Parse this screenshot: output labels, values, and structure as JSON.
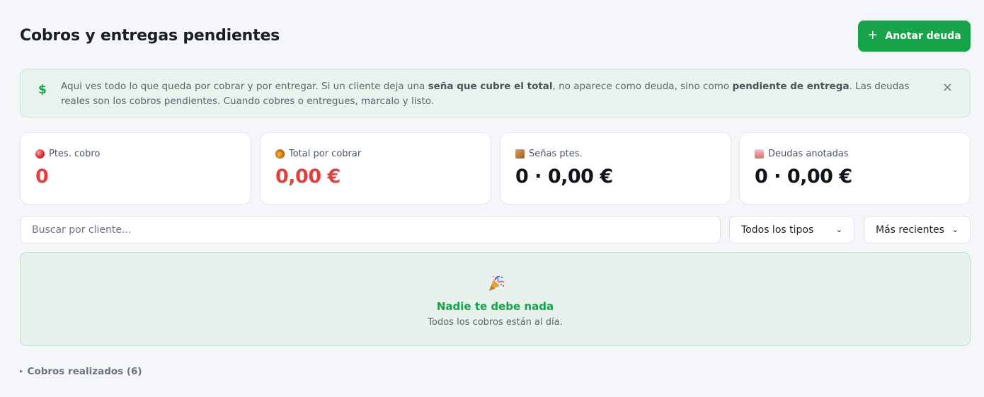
{
  "header": {
    "title": "Cobros y entregas pendientes",
    "add_button": {
      "icon": "plus-icon",
      "icon_glyph": "+",
      "label": "Anotar deuda"
    }
  },
  "info_banner": {
    "icon": "dollar-icon",
    "icon_glyph": "$",
    "text_1": "Aqui ves todo lo que queda por cobrar y por entregar. Si un cliente deja una ",
    "bold_1": "seña que cubre el total",
    "text_2": ", no aparece como deuda, sino como ",
    "bold_2": "pendiente de entrega",
    "text_3": ". Las deudas reales son los cobros pendientes. Cuando cobres o entregues, marcalo y listo.",
    "close_glyph": "×"
  },
  "stats": [
    {
      "icon": "red-circle-icon",
      "label": "Ptes. cobro",
      "value": "0",
      "color": "#e53e3e"
    },
    {
      "icon": "money-bag-icon",
      "label": "Total por cobrar",
      "value": "0,00 €",
      "color": "#e53e3e"
    },
    {
      "icon": "package-icon",
      "label": "Señas ptes.",
      "value": "0 · 0,00 €",
      "color": "#111418"
    },
    {
      "icon": "memo-icon",
      "label": "Deudas anotadas",
      "value": "0 · 0,00 €",
      "color": "#111418"
    }
  ],
  "filters": {
    "search_placeholder": "Buscar por cliente...",
    "search_value": "",
    "type_select": "Todos los tipos",
    "sort_select": "Más recientes",
    "chevron_glyph": "⌄"
  },
  "empty_state": {
    "icon": "party-popper-icon",
    "title": "Nadie te debe nada",
    "subtitle": "Todos los cobros están al día."
  },
  "completed": {
    "triangle_glyph": "▸",
    "label": "Cobros realizados (6)"
  },
  "colors": {
    "accent": "#16a34a",
    "background": "#f5f6fa",
    "danger": "#e53e3e"
  }
}
